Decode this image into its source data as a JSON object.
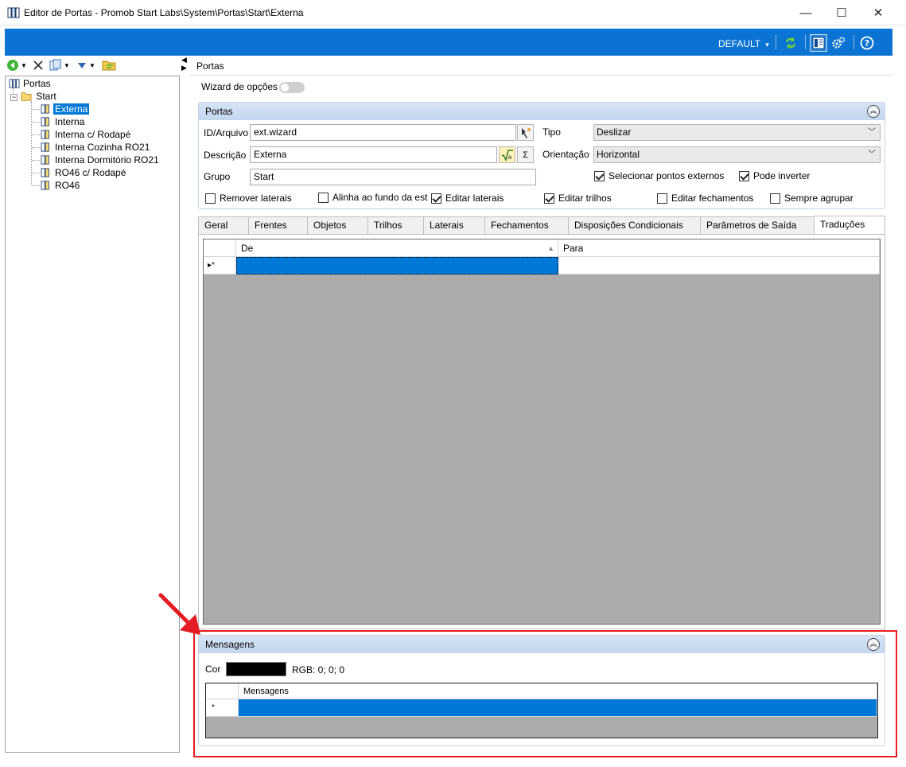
{
  "window": {
    "title": "Editor de Portas - Promob Start Labs\\System\\Portas\\Start\\Externa",
    "minimize": "—",
    "maximize": "☐",
    "close": "✕"
  },
  "ribbon": {
    "profile": "DEFAULT",
    "profile_arrow": "▾",
    "accent": "#0b73d2"
  },
  "toolbar": {
    "icons": [
      "back-icon",
      "delete-icon",
      "copy-icon",
      "move-down-icon",
      "folder-icon"
    ]
  },
  "tree": {
    "root": "Portas",
    "folder": "Start",
    "items": [
      "Externa",
      "Interna",
      "Interna c/ Rodapé",
      "Interna Cozinha RO21",
      "Interna Dormitório RO21",
      "RO46 c/ Rodapé",
      "RO46"
    ],
    "selected_index": 0
  },
  "panel": {
    "title": "Portas",
    "wizard_label": "Wizard de opções"
  },
  "portas_group": {
    "title": "Portas",
    "id_label": "ID/Arquivo",
    "id_value": "ext.wizard",
    "desc_label": "Descrição",
    "desc_value": "Externa",
    "group_label": "Grupo",
    "group_value": "Start",
    "tipo_label": "Tipo",
    "tipo_value": "Deslizar",
    "orient_label": "Orientação",
    "orient_value": "Horizontal",
    "sigma": "Σ",
    "checks": [
      {
        "label": "Selecionar pontos externos",
        "checked": true
      },
      {
        "label": "Pode inverter",
        "checked": true
      },
      {
        "label": "Remover laterais",
        "checked": false
      },
      {
        "label": "Alinha ao fundo da est",
        "checked": false
      },
      {
        "label": "Editar laterais",
        "checked": true
      },
      {
        "label": "Editar trilhos",
        "checked": true
      },
      {
        "label": "Editar fechamentos",
        "checked": false
      },
      {
        "label": "Sempre agrupar",
        "checked": false
      }
    ]
  },
  "tabs": [
    "Geral",
    "Frentes",
    "Objetos",
    "Trilhos",
    "Laterais",
    "Fechamentos",
    "Disposições Condicionais",
    "Parâmetros de Saída",
    "Traduções"
  ],
  "active_tab": "Traduções",
  "translations_grid": {
    "columns": [
      "De",
      "Para"
    ],
    "new_row_marker": "▸*"
  },
  "messages": {
    "title": "Mensagens",
    "color_label": "Cor",
    "color_value": "#000000",
    "rgb_text": "RGB: 0; 0; 0",
    "grid_column": "Mensagens",
    "new_row_marker": "*"
  }
}
